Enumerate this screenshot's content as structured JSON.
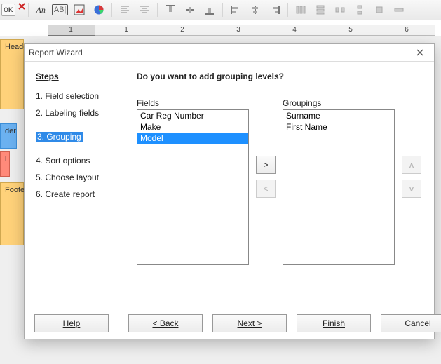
{
  "toolbar": {
    "items": [
      "close-dialog",
      "italic-an",
      "text-field",
      "image-placeholder",
      "pie-chart",
      "align-left-lines",
      "align-center-lines",
      "align-top",
      "align-vcenter",
      "align-bottom",
      "align-left",
      "align-hcenter",
      "align-right",
      "distribute-top",
      "distribute-vcenter",
      "distribute-bottom",
      "distribute-left",
      "distribute-right"
    ]
  },
  "ruler": {
    "labels": [
      "1",
      "1",
      "2",
      "3",
      "4",
      "5",
      "6"
    ]
  },
  "bands": {
    "header": "Header",
    "der": "der",
    "il": "l",
    "footer": "Footer"
  },
  "dialog": {
    "title": "Report Wizard",
    "steps_heading": "Steps",
    "steps": [
      "1. Field selection",
      "2. Labeling fields",
      "3. Grouping",
      "4. Sort options",
      "5. Choose layout",
      "6. Create report"
    ],
    "current_step_index": 2,
    "question": "Do you want to add grouping levels?",
    "fields_label": "Fields",
    "fields": [
      "Car Reg Number",
      "Make",
      "Model"
    ],
    "fields_selected_index": 2,
    "groupings_label": "Groupings",
    "groupings": [
      "Surname",
      "First Name"
    ],
    "move_right": ">",
    "move_left": "<",
    "move_up": "ᴧ",
    "move_down": "ᴠ",
    "buttons": {
      "help": "Help",
      "back": "< Back",
      "next": "Next >",
      "finish": "Finish",
      "cancel": "Cancel"
    }
  }
}
